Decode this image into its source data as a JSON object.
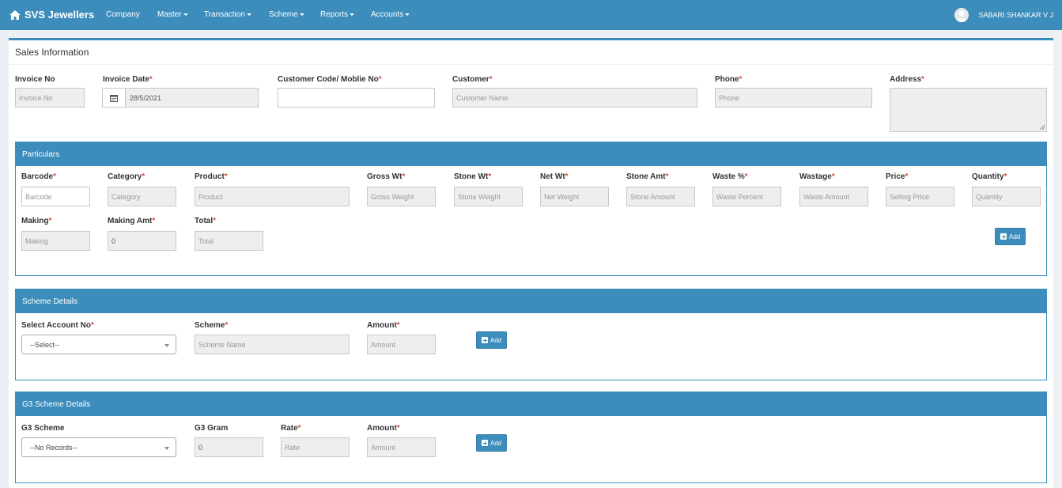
{
  "nav": {
    "brand": "SVS Jewellers",
    "items": [
      {
        "label": "Company",
        "dropdown": false
      },
      {
        "label": "Master",
        "dropdown": true
      },
      {
        "label": "Transaction",
        "dropdown": true
      },
      {
        "label": "Scheme",
        "dropdown": true
      },
      {
        "label": "Reports",
        "dropdown": true
      },
      {
        "label": "Accounts",
        "dropdown": true
      }
    ],
    "user": "SABARI SHANKAR V J"
  },
  "colors": {
    "primary": "#3c8dbc",
    "required": "#dd4b39",
    "disabled_bg": "#eeeeee"
  },
  "sales": {
    "title": "Sales Information",
    "invoice_no": {
      "label": "Invoice No",
      "placeholder": "Invoice No"
    },
    "invoice_date": {
      "label": "Invoice Date",
      "value": "28/5/2021"
    },
    "customer_code": {
      "label": "Customer Code/ Moblie No",
      "value": ""
    },
    "customer": {
      "label": "Customer",
      "placeholder": "Customer Name"
    },
    "phone": {
      "label": "Phone",
      "placeholder": "Phone"
    },
    "address": {
      "label": "Address",
      "placeholder": ""
    },
    "required_mark": "*"
  },
  "particulars": {
    "title": "Particulars",
    "barcode": {
      "label": "Barcode",
      "placeholder": "Barcode"
    },
    "category": {
      "label": "Category",
      "placeholder": "Category"
    },
    "product": {
      "label": "Product",
      "placeholder": "Product"
    },
    "gross_wt": {
      "label": "Gross Wt",
      "placeholder": "Gross Weight"
    },
    "stone_wt": {
      "label": "Stone Wt",
      "placeholder": "Stone Weight"
    },
    "net_wt": {
      "label": "Net Wt",
      "placeholder": "Net Weight"
    },
    "stone_amt": {
      "label": "Stone Amt",
      "placeholder": "Stone Amount"
    },
    "waste_pct": {
      "label": "Waste %",
      "placeholder": "Waste Percent"
    },
    "wastage": {
      "label": "Wastage",
      "placeholder": "Waste Amount"
    },
    "price": {
      "label": "Price",
      "placeholder": "Selling Price"
    },
    "quantity": {
      "label": "Quantity",
      "placeholder": "Quantity"
    },
    "making": {
      "label": "Making",
      "placeholder": "Making"
    },
    "making_amt": {
      "label": "Making Amt",
      "value": "0"
    },
    "total": {
      "label": "Total",
      "placeholder": "Total"
    },
    "add_label": "Add"
  },
  "scheme": {
    "title": "Scheme Details",
    "account": {
      "label": "Select Account No",
      "selected": "--Select--"
    },
    "scheme": {
      "label": "Scheme",
      "placeholder": "Scheme Name"
    },
    "amount": {
      "label": "Amount",
      "placeholder": "Amount"
    },
    "add_label": "Add"
  },
  "g3": {
    "title": "G3 Scheme Details",
    "scheme": {
      "label": "G3 Scheme",
      "selected": "--No Records--"
    },
    "gram": {
      "label": "G3 Gram",
      "value": "0"
    },
    "rate": {
      "label": "Rate",
      "placeholder": "Rate"
    },
    "amount": {
      "label": "Amount",
      "placeholder": "Amount"
    },
    "add_label": "Add"
  }
}
